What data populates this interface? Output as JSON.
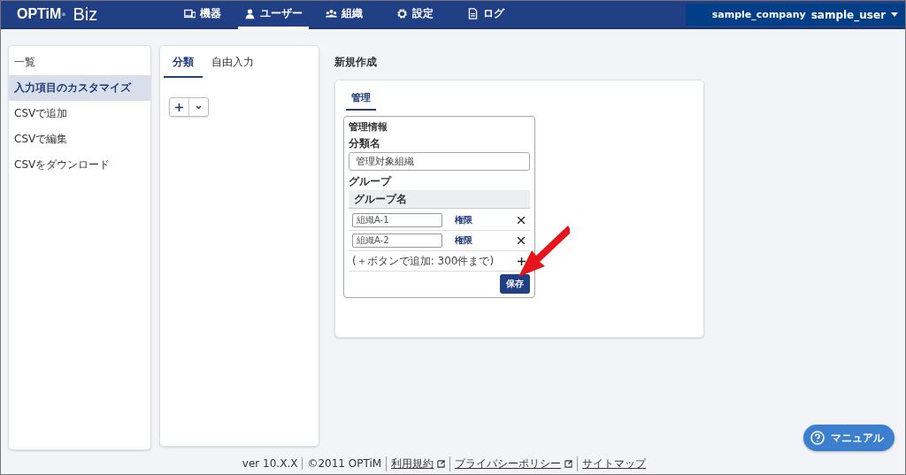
{
  "header": {
    "logo": "OPTiM",
    "logo_mark": "®",
    "product": "Biz",
    "nav": [
      {
        "label": "機器",
        "selected": false
      },
      {
        "label": "ユーザー",
        "selected": true
      },
      {
        "label": "組織",
        "selected": false
      },
      {
        "label": "設定",
        "selected": false
      },
      {
        "label": "ログ",
        "selected": false
      }
    ],
    "company": "sample_company",
    "user": "sample_user"
  },
  "sidebar": {
    "items": [
      {
        "label": "一覧",
        "selected": false
      },
      {
        "label": "入力項目のカスタマイズ",
        "selected": true
      },
      {
        "label": "CSVで追加",
        "selected": false
      },
      {
        "label": "CSVで編集",
        "selected": false
      },
      {
        "label": "CSVをダウンロード",
        "selected": false
      }
    ]
  },
  "middle": {
    "tabs": [
      {
        "label": "分類",
        "selected": true
      },
      {
        "label": "自由入力",
        "selected": false
      }
    ]
  },
  "main": {
    "title": "新規作成",
    "tabs": [
      {
        "label": "管理",
        "selected": true
      }
    ],
    "section_title": "管理情報",
    "name_label": "分類名",
    "name_value": "管理対象組織",
    "group_label": "グループ",
    "group_header": "グループ名",
    "groups": [
      {
        "name": "組織A-1",
        "link": "権限"
      },
      {
        "name": "組織A-2",
        "link": "権限"
      }
    ],
    "hint": "(＋ボタンで追加: 300件まで)",
    "save": "保存"
  },
  "footer": [
    {
      "text": "ver 10.X.X",
      "kind": "text"
    },
    {
      "text": "©2011 OPTiM",
      "kind": "text"
    },
    {
      "text": "利用規約",
      "kind": "external"
    },
    {
      "text": "プライバシーポリシー",
      "kind": "external"
    },
    {
      "text": "サイトマップ",
      "kind": "link"
    }
  ],
  "manual": "マニュアル"
}
